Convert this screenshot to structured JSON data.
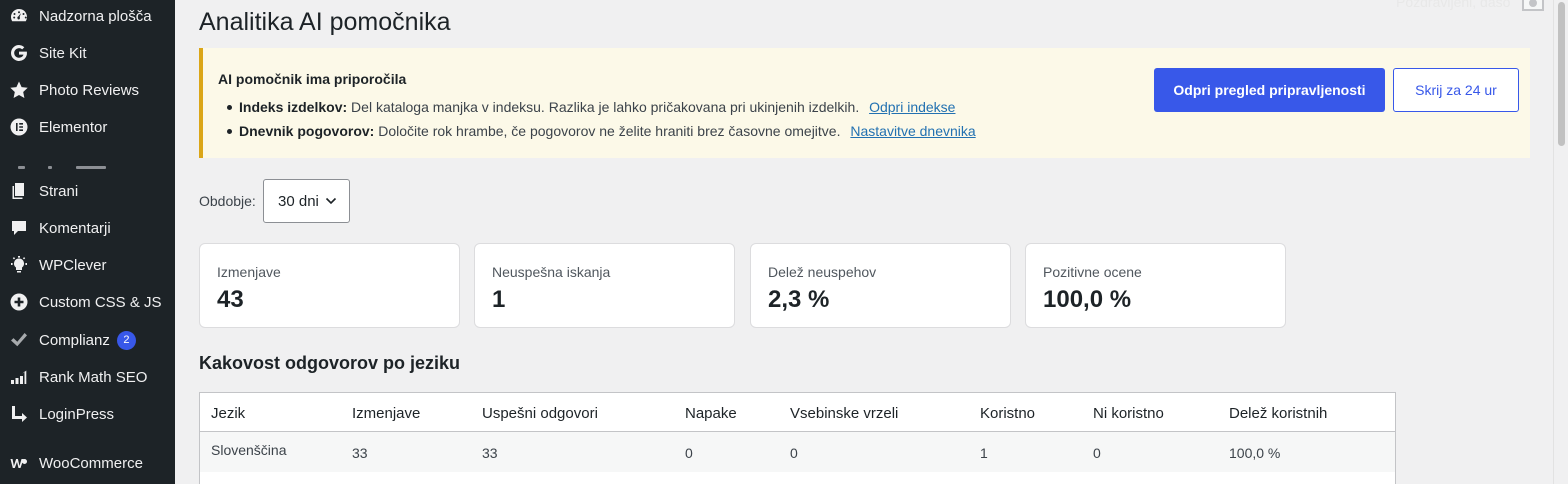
{
  "sidebar": {
    "items": [
      {
        "label": "Nadzorna plošča",
        "icon": "dashboard-icon"
      },
      {
        "label": "Site Kit",
        "icon": "google-g-icon"
      },
      {
        "label": "Photo Reviews",
        "icon": "star-icon"
      },
      {
        "label": "Elementor",
        "icon": "elementor-icon"
      },
      {
        "label": "Strani",
        "icon": "pages-icon"
      },
      {
        "label": "Komentarji",
        "icon": "comment-icon"
      },
      {
        "label": "WPClever",
        "icon": "lightbulb-icon"
      },
      {
        "label": "Custom CSS & JS",
        "icon": "plus-circle-icon"
      },
      {
        "label": "Complianz",
        "icon": "check-icon",
        "badge": "2"
      },
      {
        "label": "Rank Math SEO",
        "icon": "chart-icon"
      },
      {
        "label": "LoginPress",
        "icon": "arrow-return-icon"
      },
      {
        "label": "WooCommerce",
        "icon": "woo-icon"
      }
    ]
  },
  "admin_bar": {
    "greeting": "Pozdravljeni, daso"
  },
  "page": {
    "title": "Analitika AI pomočnika"
  },
  "notice": {
    "title": "AI pomočnik ima priporočila",
    "items": [
      {
        "bold": "Indeks izdelkov:",
        "text": "Del kataloga manjka v indeksu. Razlika je lahko pričakovana pri ukinjenih izdelkih.",
        "link": "Odpri indekse"
      },
      {
        "bold": "Dnevnik pogovorov:",
        "text": "Določite rok hrambe, če pogovorov ne želite hraniti brez časovne omejitve.",
        "link": "Nastavitve dnevnika"
      }
    ],
    "primary_button": "Odpri pregled pripravljenosti",
    "secondary_button": "Skrij za 24 ur"
  },
  "period": {
    "label": "Obdobje:",
    "value": "30 dni"
  },
  "stats": [
    {
      "label": "Izmenjave",
      "value": "43"
    },
    {
      "label": "Neuspešna iskanja",
      "value": "1"
    },
    {
      "label": "Delež neuspehov",
      "value": "2,3 %"
    },
    {
      "label": "Pozitivne ocene",
      "value": "100,0 %"
    }
  ],
  "quality": {
    "title": "Kakovost odgovorov po jeziku",
    "columns": [
      "Jezik",
      "Izmenjave",
      "Uspešni odgovori",
      "Napake",
      "Vsebinske vrzeli",
      "Koristno",
      "Ni koristno",
      "Delež koristnih"
    ],
    "rows": [
      [
        "Slovenščina",
        "33",
        "33",
        "0",
        "0",
        "1",
        "0",
        "100,0 %"
      ]
    ]
  }
}
